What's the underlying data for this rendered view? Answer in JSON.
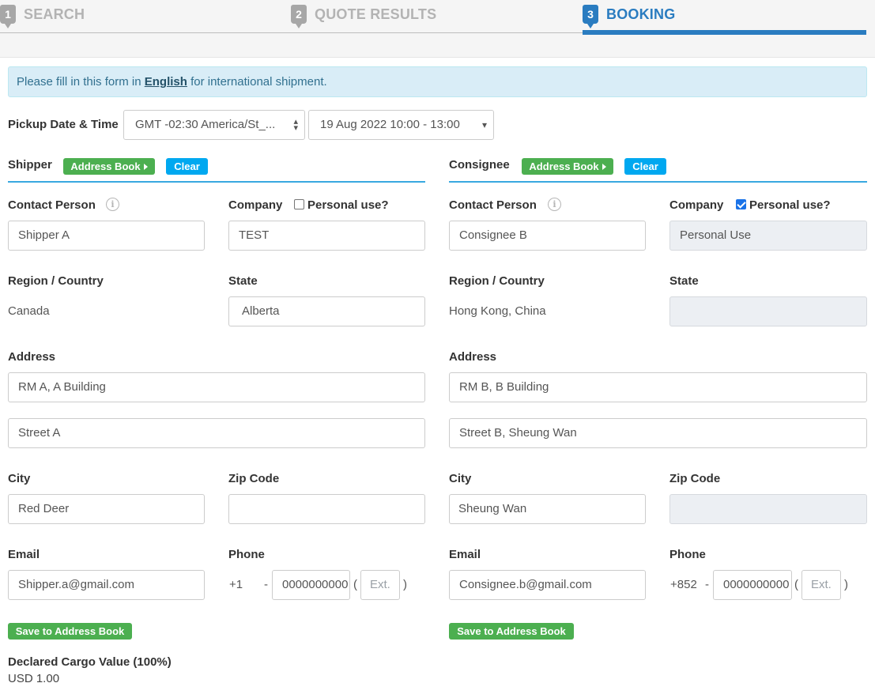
{
  "steps": [
    {
      "num": "1",
      "label": "SEARCH"
    },
    {
      "num": "2",
      "label": "QUOTE RESULTS"
    },
    {
      "num": "3",
      "label": "BOOKING"
    }
  ],
  "alert": {
    "prefix": "Please fill in this form in ",
    "link": "English",
    "suffix": " for international shipment."
  },
  "pickup": {
    "label": "Pickup Date & Time",
    "timezone": "GMT -02:30 America/St_...",
    "slot": "19 Aug 2022 10:00 - 13:00"
  },
  "buttons": {
    "address_book": "Address Book",
    "clear": "Clear",
    "save_to_address_book": "Save to Address Book"
  },
  "labels": {
    "contact_person": "Contact Person",
    "company": "Company",
    "personal_use": "Personal use?",
    "region_country": "Region / Country",
    "state": "State",
    "address": "Address",
    "city": "City",
    "zip_code": "Zip Code",
    "email": "Email",
    "phone": "Phone"
  },
  "shipper": {
    "title": "Shipper",
    "contact_person": "Shipper A",
    "company": "TEST",
    "personal_use": false,
    "region_country": "Canada",
    "state": "Alberta",
    "address1": "RM A, A Building",
    "address2": "Street A",
    "city": "Red Deer",
    "zip_code": "",
    "email": "Shipper.a@gmail.com",
    "phone_code": "+1",
    "phone_sep": "-",
    "phone_number": "0000000000",
    "ext_placeholder": "Ext."
  },
  "consignee": {
    "title": "Consignee",
    "contact_person": "Consignee B",
    "company": "Personal Use",
    "personal_use": true,
    "region_country": "Hong Kong, China",
    "state": "",
    "address1": "RM B, B Building",
    "address2": "Street B, Sheung Wan",
    "city": "Sheung Wan",
    "zip_code": "",
    "email": "Consignee.b@gmail.com",
    "phone_code": "+852",
    "phone_sep": "-",
    "phone_number": "0000000000",
    "ext_placeholder": "Ext."
  },
  "cargo": {
    "label": "Declared Cargo Value (100%)",
    "value": "USD 1.00"
  },
  "punct": {
    "open_paren": "(",
    "close_paren": ")"
  },
  "colors": {
    "accent": "#2a7cc0",
    "green_button": "#4caf50",
    "blue_button": "#00a8f0",
    "alert_bg": "#d9edf7"
  }
}
